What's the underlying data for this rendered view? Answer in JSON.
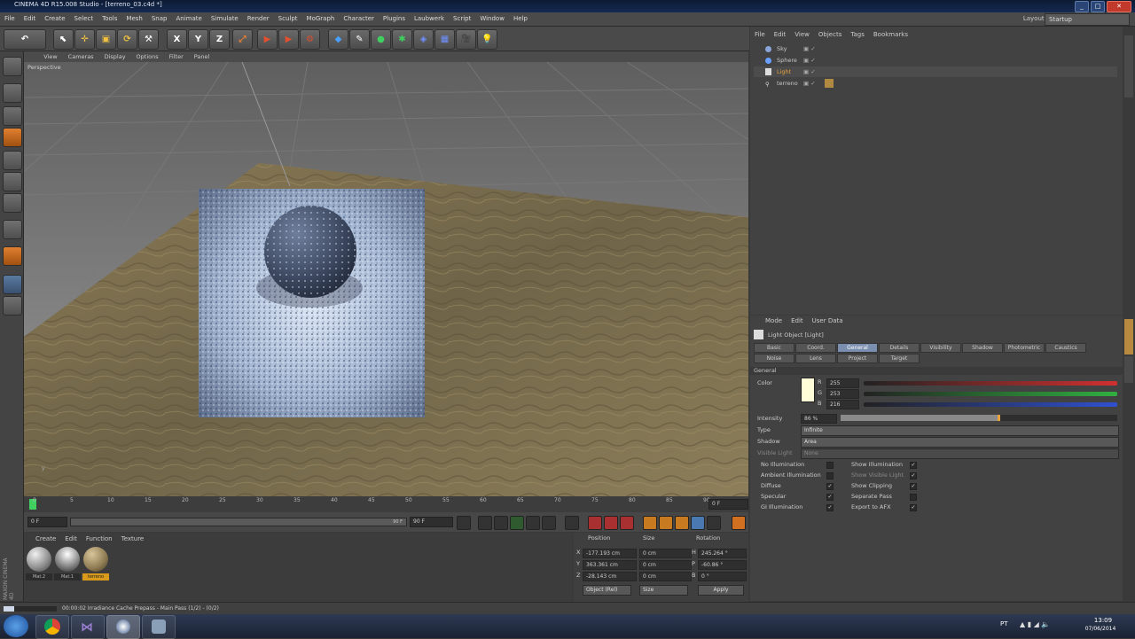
{
  "window": {
    "title": "CINEMA 4D R15.008 Studio - [terreno_03.c4d *]"
  },
  "menubar": {
    "items": [
      "File",
      "Edit",
      "Create",
      "Select",
      "Tools",
      "Mesh",
      "Snap",
      "Animate",
      "Simulate",
      "Render",
      "Sculpt",
      "MoGraph",
      "Character",
      "Plugins",
      "Laubwerk",
      "Script",
      "Window",
      "Help"
    ],
    "layout_label": "Layout:",
    "layout_value": "Startup"
  },
  "viewport": {
    "menu": [
      "View",
      "Cameras",
      "Display",
      "Options",
      "Filter",
      "Panel"
    ],
    "camera_label": "Perspective"
  },
  "timeline": {
    "ticks": [
      "0",
      "5",
      "10",
      "15",
      "20",
      "25",
      "30",
      "35",
      "40",
      "45",
      "50",
      "55",
      "60",
      "65",
      "70",
      "75",
      "80",
      "85",
      "90"
    ],
    "current_frame": "0 F",
    "start": "0 F",
    "end": "90 F",
    "range_end": "90 F"
  },
  "materials": {
    "menu": [
      "Create",
      "Edit",
      "Function",
      "Texture"
    ],
    "items": [
      {
        "name": "Mat.2"
      },
      {
        "name": "Mat.1"
      },
      {
        "name": "terreno"
      }
    ]
  },
  "coordinates": {
    "headers": [
      "Position",
      "Size",
      "Rotation"
    ],
    "rows": [
      {
        "axis": "X",
        "pos": "-177.193 cm",
        "size": "0 cm",
        "rot_axis": "H",
        "rot": "245.264 °"
      },
      {
        "axis": "Y",
        "pos": "363.361 cm",
        "size": "0 cm",
        "rot_axis": "P",
        "rot": "-60.86 °"
      },
      {
        "axis": "Z",
        "pos": "-28.143 cm",
        "size": "0 cm",
        "rot_axis": "B",
        "rot": "0 °"
      }
    ],
    "mode": "Object (Rel)",
    "size_mode": "Size",
    "apply": "Apply"
  },
  "objects": {
    "menu": [
      "File",
      "Edit",
      "View",
      "Objects",
      "Tags",
      "Bookmarks"
    ],
    "items": [
      {
        "name": "Sky"
      },
      {
        "name": "Sphere"
      },
      {
        "name": "Light"
      },
      {
        "name": "terreno"
      }
    ]
  },
  "attributes": {
    "menu": [
      "Mode",
      "Edit",
      "User Data"
    ],
    "object_title": "Light Object [Light]",
    "tabs_row1": [
      "Basic",
      "Coord.",
      "General",
      "Details",
      "Visibility",
      "Shadow",
      "Photometric",
      "Caustics"
    ],
    "tabs_row2": [
      "Noise",
      "Lens",
      "Project",
      "Target"
    ],
    "section": "General",
    "color_label": "Color",
    "color_rows": [
      {
        "ch": "R",
        "val": "255"
      },
      {
        "ch": "G",
        "val": "253"
      },
      {
        "ch": "B",
        "val": "216"
      }
    ],
    "intensity_label": "Intensity",
    "intensity_value": "86 %",
    "intensity_fraction": 0.86,
    "type_label": "Type",
    "type_value": "Infinite",
    "shadow_label": "Shadow",
    "shadow_value": "Area",
    "visible_light_label": "Visible Light",
    "visible_light_value": "None",
    "left_checks": [
      {
        "label": "No Illumination",
        "on": false
      },
      {
        "label": "Ambient Illumination",
        "on": false
      },
      {
        "label": "Diffuse",
        "on": true
      },
      {
        "label": "Specular",
        "on": true
      },
      {
        "label": "GI Illumination",
        "on": true
      }
    ],
    "right_checks": [
      {
        "label": "Show Illumination",
        "on": true
      },
      {
        "label": "Show Visible Light",
        "on": true
      },
      {
        "label": "Show Clipping",
        "on": true
      },
      {
        "label": "Separate Pass",
        "on": false
      },
      {
        "label": "Export to AFX",
        "on": true
      }
    ]
  },
  "status": {
    "text": "00:00:02 Irradiance Cache Prepass - Main Pass (1/2) - (0/2)",
    "progress": 0.2
  },
  "taskbar": {
    "lang": "PT",
    "time": "13:09",
    "date": "07/06/2014"
  }
}
